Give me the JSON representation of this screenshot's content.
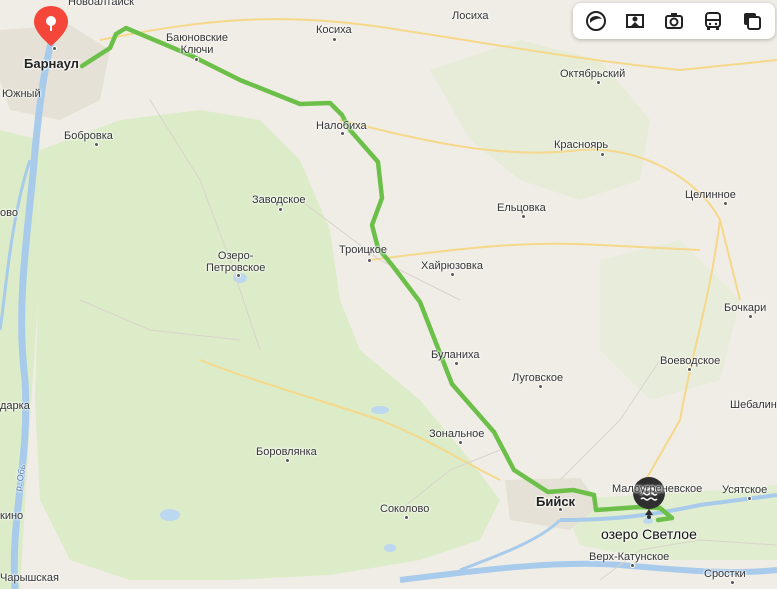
{
  "map": {
    "route_color": "#6cc04a",
    "start_marker_color": "#f4473a",
    "end_marker_color": "#2f2f2f",
    "water_color": "#bcd8f0",
    "forest_color": "#dbecc7"
  },
  "toolbar": {
    "buttons": [
      {
        "name": "layers-icon"
      },
      {
        "name": "panorama-icon"
      },
      {
        "name": "camera-icon"
      },
      {
        "name": "transit-icon"
      },
      {
        "name": "map-style-icon"
      }
    ]
  },
  "places": {
    "barnaul": "Барнаул",
    "novoaltaysk": "Новоалтайск",
    "bayunovskie_klyuchi": "Баюновские Ключи",
    "yuzhny": "Южный",
    "bobrovka": "Бобровка",
    "losikha": "Лосиха",
    "kosikha": "Косиха",
    "oktyabrsky": "Октябрьский",
    "nalobikha": "Налобиха",
    "krasnoyary": "Красноярь",
    "zavodskoe": "Заводское",
    "eltsovka": "Ельцовка",
    "tselinnoe": "Целинное",
    "troitskoe": "Троицкое",
    "ozero_petrovskoe": "Озеро-\nПетровское",
    "khairyuzovka": "Хайрюзовка",
    "bochkari": "Бочкари",
    "bulanikha": "Буланиха",
    "lugovskoe": "Луговское",
    "voevodskoe": "Воеводское",
    "shebalino": "Шебалин",
    "zonalnoe": "Зональное",
    "borovlyanka": "Боровлянка",
    "darka": "дарка",
    "biysk": "Бийск",
    "sokolovo": "Соколово",
    "malougrenevskoe": "Малоугреневское",
    "ust_isk": "Усятское",
    "ozero_svetloe": "озеро Светлое",
    "verkh_katunskoe": "Верх-Катунское",
    "srostki": "Сростки",
    "charyshskaya": "Чарышская",
    "ovo": "ово",
    "kino": "кино",
    "river_ob": "р. Обь"
  }
}
